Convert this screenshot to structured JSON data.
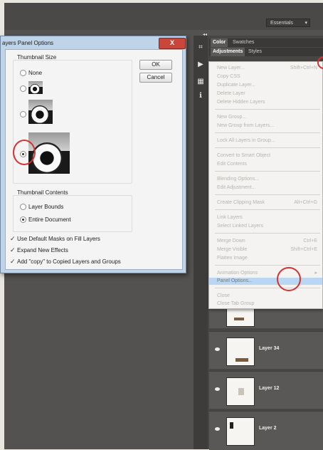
{
  "app": {
    "workspace_label": "Essentials"
  },
  "panels": {
    "tabs_row1": [
      "Color",
      "Swatches"
    ],
    "tabs_row2": [
      "Adjustments",
      "Styles"
    ]
  },
  "menu": {
    "items": [
      {
        "label": "New Layer...",
        "shortcut": "Shift+Ctrl+N"
      },
      {
        "label": "Copy CSS",
        "shortcut": ""
      },
      {
        "label": "Duplicate Layer...",
        "shortcut": ""
      },
      {
        "label": "Delete Layer",
        "shortcut": ""
      },
      {
        "label": "Delete Hidden Layers",
        "shortcut": ""
      },
      {
        "label": "New Group...",
        "shortcut": ""
      },
      {
        "label": "New Group from Layers...",
        "shortcut": ""
      },
      {
        "label": "Lock All Layers in Group...",
        "shortcut": ""
      },
      {
        "label": "Convert to Smart Object",
        "shortcut": ""
      },
      {
        "label": "Edit Contents",
        "shortcut": ""
      },
      {
        "label": "Blending Options...",
        "shortcut": ""
      },
      {
        "label": "Edit Adjustment...",
        "shortcut": ""
      },
      {
        "label": "Create Clipping Mask",
        "shortcut": "Alt+Ctrl+G"
      },
      {
        "label": "Link Layers",
        "shortcut": ""
      },
      {
        "label": "Select Linked Layers",
        "shortcut": ""
      },
      {
        "label": "Merge Down",
        "shortcut": "Ctrl+E"
      },
      {
        "label": "Merge Visible",
        "shortcut": "Shift+Ctrl+E"
      },
      {
        "label": "Flatten Image",
        "shortcut": ""
      },
      {
        "label": "Animation Options",
        "shortcut": ""
      },
      {
        "label": "Panel Options...",
        "shortcut": ""
      },
      {
        "label": "Close",
        "shortcut": ""
      },
      {
        "label": "Close Tab Group",
        "shortcut": ""
      }
    ],
    "highlighted": "Panel Options..."
  },
  "layers": [
    {
      "name": "Layer 34"
    },
    {
      "name": "Layer 12"
    },
    {
      "name": "Layer 2"
    }
  ],
  "dialog": {
    "title": "ayers Panel Options",
    "close_label": "X",
    "thumbnail_size_label": "Thumbnail Size",
    "size_options": [
      {
        "label": "None",
        "selected": false
      },
      {
        "label": "",
        "selected": false
      },
      {
        "label": "",
        "selected": false
      },
      {
        "label": "",
        "selected": true
      }
    ],
    "ok_label": "OK",
    "cancel_label": "Cancel",
    "thumbnail_contents_label": "Thumbnail Contents",
    "contents_options": [
      {
        "label": "Layer Bounds",
        "selected": false
      },
      {
        "label": "Entire Document",
        "selected": true
      }
    ],
    "checkboxes": [
      {
        "label": "Use Default Masks on Fill Layers",
        "checked": true
      },
      {
        "label": "Expand New Effects",
        "checked": true
      },
      {
        "label": "Add \"copy\" to Copied Layers and Groups",
        "checked": true
      }
    ]
  },
  "colors": {
    "highlight": "#b9d6f2",
    "annotation_circle": "#d23333",
    "workspace_bg": "#545250"
  }
}
